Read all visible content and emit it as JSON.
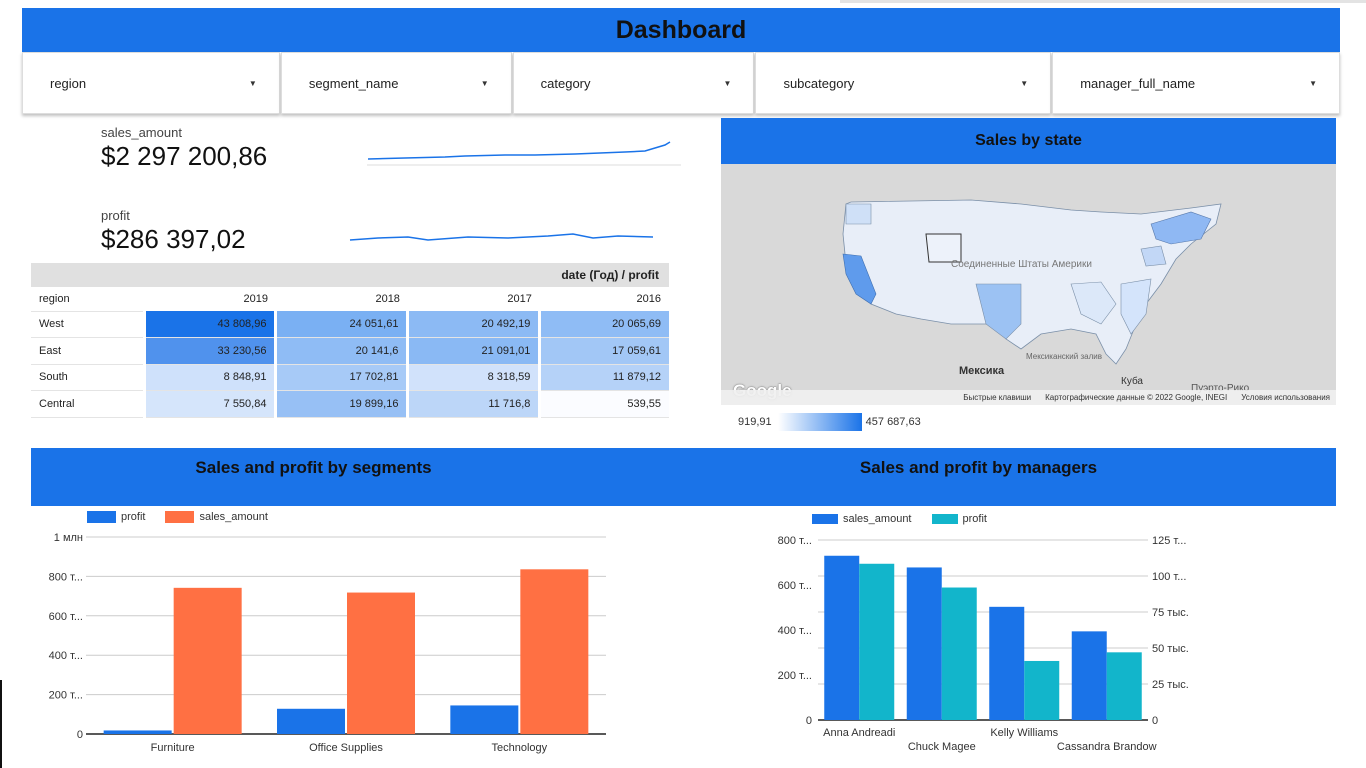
{
  "header": {
    "title": "Dashboard"
  },
  "filters": [
    {
      "label": "region"
    },
    {
      "label": "segment_name"
    },
    {
      "label": "category"
    },
    {
      "label": "subcategory"
    },
    {
      "label": "manager_full_name"
    }
  ],
  "kpis": {
    "sales": {
      "label": "sales_amount",
      "value": "$2 297 200,86"
    },
    "profit": {
      "label": "profit",
      "value": "$286 397,02"
    }
  },
  "pivot": {
    "header": "date (Год) / profit",
    "row_label": "region",
    "columns": [
      "2019",
      "2018",
      "2017",
      "2016"
    ],
    "rows": [
      {
        "region": "West",
        "values": [
          "43 808,96",
          "24 051,61",
          "20 492,19",
          "20 065,69"
        ]
      },
      {
        "region": "East",
        "values": [
          "33 230,56",
          "20 141,6",
          "21 091,01",
          "17 059,61"
        ]
      },
      {
        "region": "South",
        "values": [
          "8 848,91",
          "17 702,81",
          "8 318,59",
          "11 879,12"
        ]
      },
      {
        "region": "Central",
        "values": [
          "7 550,84",
          "19 899,16",
          "11 716,8",
          "539,55"
        ]
      }
    ],
    "shades": [
      [
        "#1a73e8",
        "#7ab0f3",
        "#8cbaf4",
        "#8fbcf5"
      ],
      [
        "#5092ed",
        "#8fbcf5",
        "#8ab9f4",
        "#a2c7f6"
      ],
      [
        "#cfe1fb",
        "#a7caf7",
        "#d1e2fb",
        "#b5d2f8"
      ],
      [
        "#d5e5fb",
        "#97c0f5",
        "#bcd6f8",
        "#fbfcff"
      ]
    ]
  },
  "map": {
    "title": "Sales by state",
    "logo": "Google",
    "footer": [
      "Быстрые клавиши",
      "Картографические данные © 2022 Google, INEGI",
      "Условия использования"
    ],
    "labels": {
      "country": "Соединенные Штаты Америки",
      "mexico": "Мексика",
      "gulf": "Мексиканский залив",
      "cuba": "Куба",
      "puerto": "Пуэрто-Рико"
    },
    "scale_min": "919,91",
    "scale_max": "457 687,63"
  },
  "seg_section": {
    "title": "Sales and profit by segments"
  },
  "mgr_section": {
    "title": "Sales and profit by managers"
  },
  "colors": {
    "blue": "#1a73e8",
    "orange": "#ff7043",
    "teal": "#12b5cb"
  },
  "chart_data": [
    {
      "type": "bar",
      "title": "Sales and profit by segments",
      "categories": [
        "Furniture",
        "Office Supplies",
        "Technology"
      ],
      "series": [
        {
          "name": "profit",
          "values": [
            18000,
            128000,
            145000
          ]
        },
        {
          "name": "sales_amount",
          "values": [
            742000,
            718000,
            836000
          ]
        }
      ],
      "ylim": [
        0,
        1000000
      ],
      "yticks": [
        "0",
        "200 т...",
        "400 т...",
        "600 т...",
        "800 т...",
        "1 млн"
      ],
      "legend": "top-left",
      "grid": true
    },
    {
      "type": "bar",
      "title": "Sales and profit by managers",
      "categories": [
        "Anna Andreadi",
        "Chuck Magee",
        "Kelly Williams",
        "Cassandra Brandow"
      ],
      "series": [
        {
          "name": "sales_amount",
          "values": [
            730000,
            678000,
            503000,
            394000
          ],
          "axis": "left"
        },
        {
          "name": "profit",
          "values": [
            108500,
            92000,
            41000,
            47000
          ],
          "axis": "right"
        }
      ],
      "ylim_left": [
        0,
        800000
      ],
      "ylim_right": [
        0,
        125000
      ],
      "yticks_left": [
        "0",
        "200 т...",
        "400 т...",
        "600 т...",
        "800 т..."
      ],
      "yticks_right": [
        "0",
        "25 тыс.",
        "50 тыс.",
        "75 тыс.",
        "100 т...",
        "125 т..."
      ],
      "legend": "top-left",
      "grid": true
    }
  ]
}
